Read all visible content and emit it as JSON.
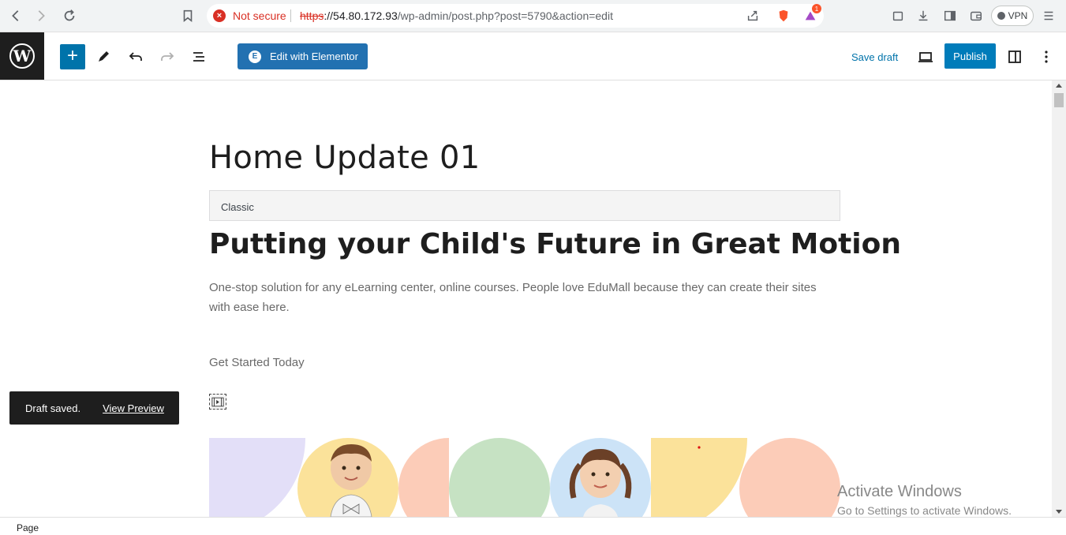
{
  "browser": {
    "security_label": "Not secure",
    "url_proto": "https",
    "url_host": "://54.80.172.93",
    "url_path": "/wp-admin/post.php?post=5790&action=edit",
    "vpn_label": "VPN",
    "notification_count": "1"
  },
  "toolbar": {
    "elementor_label": "Edit with Elementor",
    "save_draft_label": "Save draft",
    "publish_label": "Publish",
    "accent": "#007cba"
  },
  "editor": {
    "post_title": "Home Update 01",
    "classic_label": "Classic",
    "hero_heading": "Putting your Child's Future in Great Motion",
    "hero_text": "One-stop solution for any eLearning center, online courses. People love EduMall because they can create their sites with ease here.",
    "cta_text": "Get Started Today",
    "shape_colors": [
      "#e3dff8",
      "#fbe29a",
      "#fcccb8",
      "#c6e2c3",
      "#cce3f7",
      "#fbe29a",
      "#fcccb8"
    ]
  },
  "snackbar": {
    "message": "Draft saved.",
    "action": "View Preview"
  },
  "watermark": {
    "line1": "Activate Windows",
    "line2": "Go to Settings to activate Windows."
  },
  "footer": {
    "breadcrumb": "Page"
  }
}
